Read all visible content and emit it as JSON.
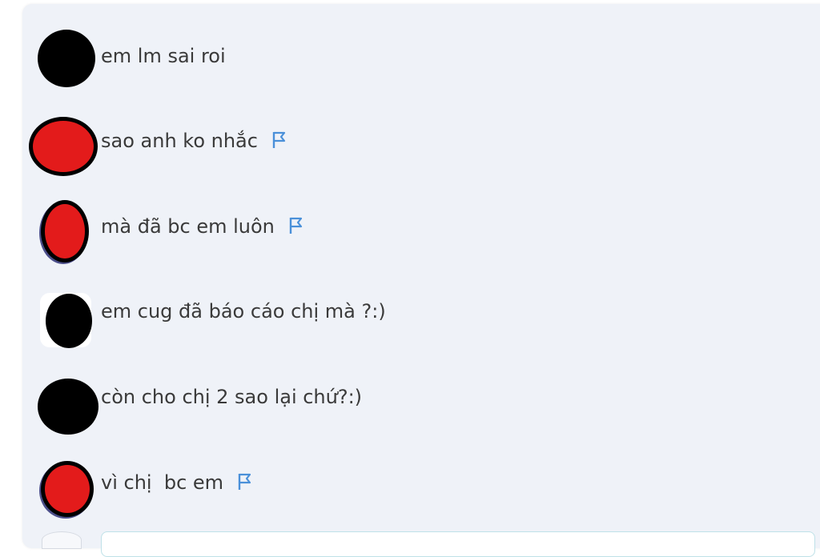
{
  "messages": [
    {
      "text": "em lm sai roi",
      "flag": false,
      "avatar_color": "#000000",
      "avatar_style": "black"
    },
    {
      "text": "sao anh ko nhắc",
      "flag": true,
      "avatar_color": "#e31b1b",
      "avatar_style": "red-wide"
    },
    {
      "text": "mà đã bc em luôn",
      "flag": true,
      "avatar_color": "#e31b1b",
      "avatar_style": "red-tall"
    },
    {
      "text": "em cug đã báo cáo chị mà ?:)",
      "flag": false,
      "avatar_color": "#000000",
      "avatar_style": "black-small"
    },
    {
      "text": "còn cho chị 2 sao lại chứ?:)",
      "flag": false,
      "avatar_color": "#000000",
      "avatar_style": "black"
    },
    {
      "text": "vì chị  bc em",
      "flag": true,
      "avatar_color": "#e31b1b",
      "avatar_style": "red-tall"
    }
  ],
  "colors": {
    "panel_bg": "#eff2f8",
    "text": "#3a3a3a",
    "flag_icon": "#4a90d9"
  }
}
